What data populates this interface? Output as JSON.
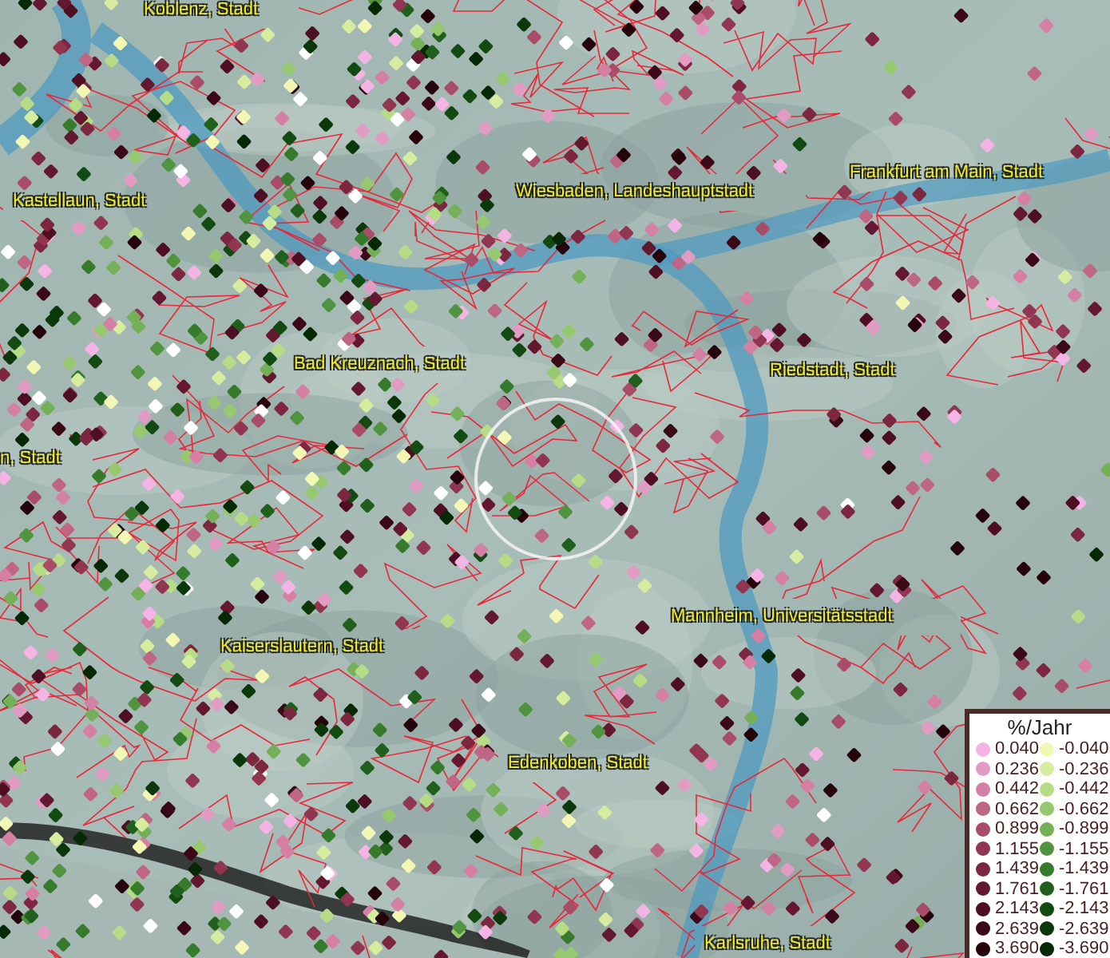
{
  "map": {
    "places": [
      {
        "name": "Koblenz, Stadt"
      },
      {
        "name": "Kastellaun, Stadt"
      },
      {
        "name": "Wiesbaden, Landeshauptstadt"
      },
      {
        "name": "Frankfurt am Main, Stadt"
      },
      {
        "name": "Bad Kreuznach, Stadt"
      },
      {
        "name": "Riedstadt, Stadt"
      },
      {
        "name": "n, Stadt"
      },
      {
        "name": "Kaiserslautern, Stadt"
      },
      {
        "name": "Mannheim, Universitätsstadt"
      },
      {
        "name": "Edenkoben, Stadt"
      },
      {
        "name": "Karlsruhe, Stadt"
      }
    ]
  },
  "legend": {
    "title": "%/Jahr",
    "entries": [
      {
        "label": "0.040",
        "color": "#f4b4e4"
      },
      {
        "label": "-0.040",
        "color": "#f2f7b4"
      },
      {
        "label": "0.236",
        "color": "#e29cc4"
      },
      {
        "label": "-0.236",
        "color": "#d6ec9e"
      },
      {
        "label": "0.442",
        "color": "#d47fa3"
      },
      {
        "label": "-0.442",
        "color": "#b6dc86"
      },
      {
        "label": "0.662",
        "color": "#c06685"
      },
      {
        "label": "-0.662",
        "color": "#96c870"
      },
      {
        "label": "0.899",
        "color": "#a84c68"
      },
      {
        "label": "-0.899",
        "color": "#74b058"
      },
      {
        "label": "1.155",
        "color": "#903650"
      },
      {
        "label": "-1.155",
        "color": "#509440"
      },
      {
        "label": "1.439",
        "color": "#7c2640"
      },
      {
        "label": "-1.439",
        "color": "#367a2c"
      },
      {
        "label": "1.761",
        "color": "#641830"
      },
      {
        "label": "-1.761",
        "color": "#20601c"
      },
      {
        "label": "2.143",
        "color": "#4e0f22"
      },
      {
        "label": "-2.143",
        "color": "#124a12"
      },
      {
        "label": "2.639",
        "color": "#3a0816"
      },
      {
        "label": "-2.639",
        "color": "#0a380a"
      },
      {
        "label": "3.690",
        "color": "#26040c"
      },
      {
        "label": "-3.690",
        "color": "#052805"
      }
    ]
  }
}
